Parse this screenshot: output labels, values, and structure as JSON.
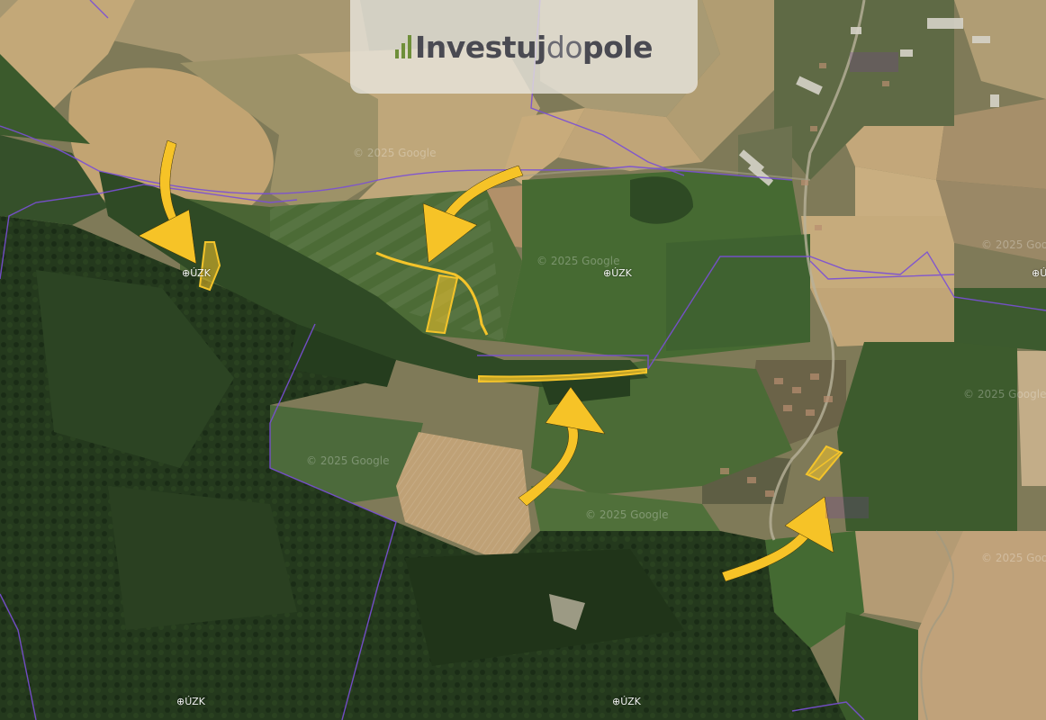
{
  "logo": {
    "part1": "Investuj",
    "part2": "do",
    "part3": "pole",
    "accent": "#6f8f3a"
  },
  "watermarks": {
    "uzk": "ÚZK",
    "google": "© 2025 Google"
  },
  "parcel_labels": [
    {
      "id": "village-north",
      "line1": "",
      "line2": ""
    },
    {
      "id": "village-south",
      "line1": "",
      "line2": ""
    }
  ],
  "colors": {
    "highlight": "#f4c42a",
    "arrow": "#f6c327",
    "boundary": "#7a4fd6",
    "forest": "#263a1f",
    "meadow": "#3e5a2c",
    "field_tan": "#b59b6c"
  },
  "marked_parcels_count": 5
}
